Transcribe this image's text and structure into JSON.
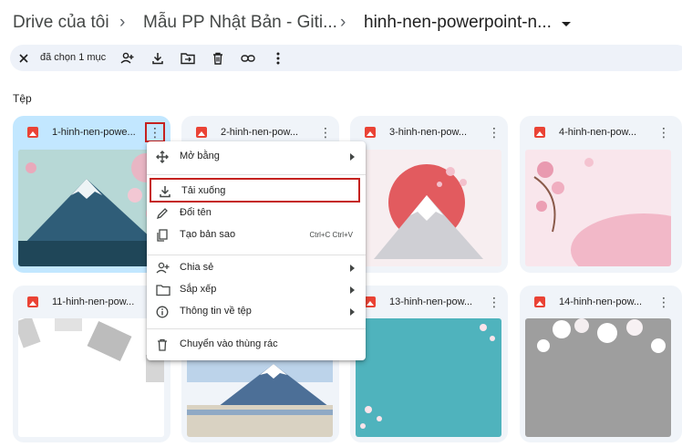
{
  "breadcrumb": {
    "root": "Drive của tôi",
    "folder": "Mẫu PP Nhật Bản - Giti...",
    "current": "hinh-nen-powerpoint-n..."
  },
  "selection_bar": {
    "text": "đã chọn 1 mục"
  },
  "section_label": "Tệp",
  "files": [
    {
      "name": "1-hinh-nen-powe..."
    },
    {
      "name": "2-hinh-nen-pow..."
    },
    {
      "name": "3-hinh-nen-pow..."
    },
    {
      "name": "4-hinh-nen-pow..."
    },
    {
      "name": "11-hinh-nen-pow..."
    },
    {
      "name": "13-hinh-nen-pow..."
    },
    {
      "name": "14-hinh-nen-pow..."
    }
  ],
  "menu": {
    "open_with": "Mở bằng",
    "download": "Tải xuống",
    "rename": "Đổi tên",
    "make_copy": "Tạo bản sao",
    "make_copy_shortcut": "Ctrl+C Ctrl+V",
    "share": "Chia sẻ",
    "organize": "Sắp xếp",
    "file_info": "Thông tin về tệp",
    "trash": "Chuyển vào thùng rác"
  },
  "colors": {
    "selected_card": "#c2e7ff",
    "card": "#f0f4f9",
    "highlight": "#c5221f",
    "file_icon": "#ea4335"
  }
}
